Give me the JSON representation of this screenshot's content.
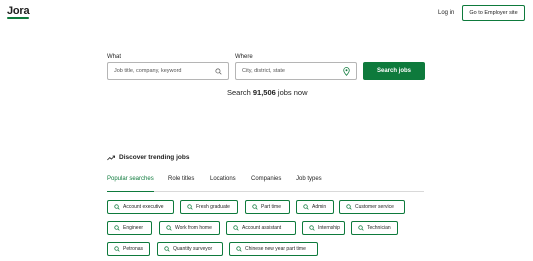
{
  "header": {
    "logo_text": "Jora",
    "login_label": "Log in",
    "employer_label": "Go to Employer site"
  },
  "search": {
    "what_label": "What",
    "what_placeholder": "Job title, company, keyword",
    "where_label": "Where",
    "where_placeholder": "City, district, state",
    "button_label": "Search jobs",
    "count_prefix": "Search ",
    "count_value": "91,506",
    "count_suffix": " jobs now"
  },
  "trending": {
    "heading": "Discover trending jobs",
    "tabs": [
      "Popular searches",
      "Role titles",
      "Locations",
      "Companies",
      "Job types"
    ],
    "active_tab": "Popular searches",
    "chips": [
      "Account executive",
      "Fresh graduate",
      "Part time",
      "Admin",
      "Customer service",
      "Engineer",
      "Work from home",
      "Account assistant",
      "Internship",
      "Technician",
      "Petronas",
      "Quantity surveyor",
      "Chinese new year part time"
    ]
  },
  "colors": {
    "brand_green": "#0e7a3c",
    "text": "#1f1f1f",
    "border": "#b5b5b5"
  },
  "icons": [
    "search-icon",
    "location-pin-icon",
    "trending-icon"
  ]
}
